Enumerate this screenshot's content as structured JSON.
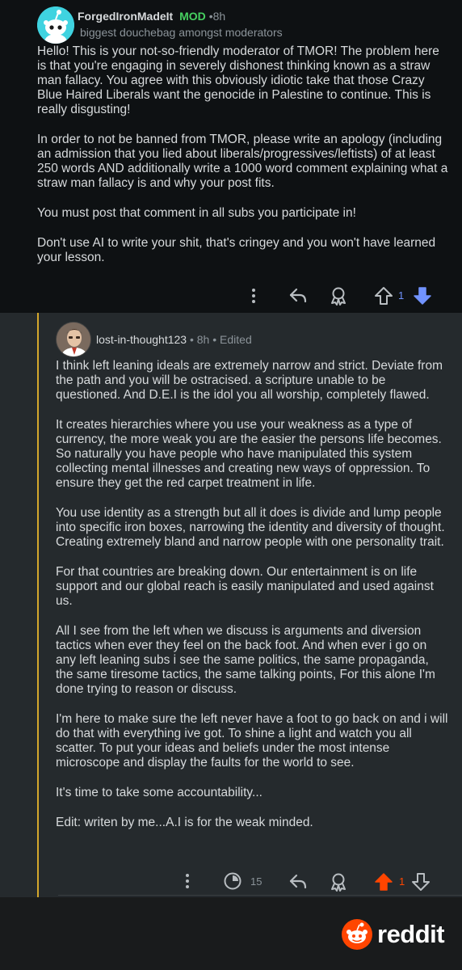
{
  "top_comment": {
    "username": "ForgedIronMadeIt",
    "mod_badge": "MOD",
    "separator": "•",
    "time": "8h",
    "flair": "biggest douchebag amongst moderators",
    "paragraphs": [
      "Hello! This is your not-so-friendly moderator of TMOR! The problem here is that you're engaging in severely dishonest thinking known as a straw man fallacy. You agree with this obviously idiotic take that those Crazy Blue Haired Liberals want the genocide in Palestine to continue. This is really disgusting!",
      "In order to not be banned from TMOR, please write an apology (including an admission that you lied about liberals/progressives/leftists) of at least 250 words AND additionally write a 1000 word comment explaining what a straw man fallacy is and why your post fits.",
      "You must post that comment in all subs you participate in!",
      "Don't use AI to write your shit, that's cringey and you won't have learned your lesson."
    ],
    "vote_count": "1",
    "icons": [
      "more-options-icon",
      "reply-icon",
      "award-icon",
      "upvote-icon",
      "downvote-icon"
    ]
  },
  "reply": {
    "username": "lost-in-thought123",
    "separator": "•",
    "time": "8h",
    "edited": "Edited",
    "paragraphs": [
      "I think left leaning ideals are extremely narrow and strict. Deviate from the path and you will be ostracised. a scripture unable to be questioned. And D.E.I is the idol you all worship, completely flawed.",
      "It creates hierarchies where you use your weakness as a type of currency, the more weak you are the easier the persons life becomes. So naturally you have people who have manipulated this system collecting mental illnesses and creating new ways of oppression. To ensure they get the red carpet treatment in life.",
      "You use identity as a strength but all it does is divide and lump people into specific iron boxes, narrowing the identity and diversity of thought. Creating extremely bland and narrow people with one personality trait.",
      "For that countries are breaking down. Our entertainment is on life support and our global reach is easily manipulated and used against us.",
      "All I see from the left when we discuss is arguments and diversion tactics when ever they feel on the back foot. And when ever i go on any left leaning subs i see the same politics, the same propaganda, the same tiresome tactics, the same talking points, For this alone I'm done trying to reason or discuss.",
      "I'm here to make sure the left never have a foot to go back on and i will do that with everything ive got. To shine a light and watch you all scatter. To put your ideas and beliefs under the most intense microscope and display the faults for the world to see.",
      "It's time to take some accountability...",
      "Edit: writen by me...A.I is for the weak minded."
    ],
    "views_count": "15",
    "vote_count": "1",
    "icons": [
      "more-options-icon",
      "views-icon",
      "reply-icon",
      "award-icon",
      "upvote-icon",
      "downvote-icon"
    ]
  },
  "footer": {
    "logo_text": "reddit"
  },
  "colors": {
    "mod_green": "#46d160",
    "upvote_orange": "#ff4500",
    "downvote_blue": "#7193ff",
    "thread_line": "#d4a72c"
  }
}
